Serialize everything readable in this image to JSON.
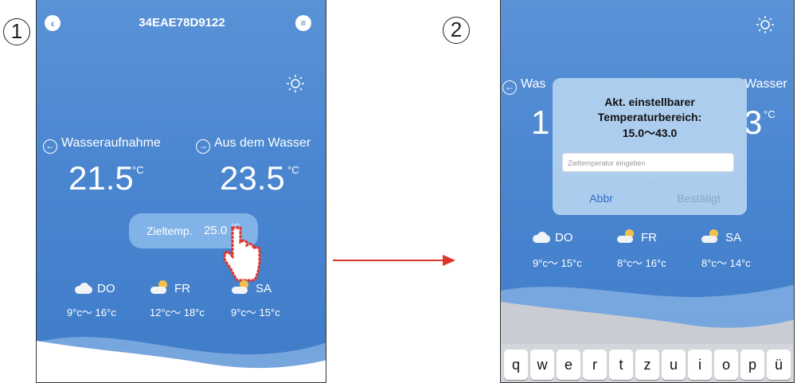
{
  "steps": {
    "one": "1",
    "two": "2"
  },
  "phone1": {
    "title": "34EAE78D9122",
    "back_icon": "chevron-left-icon",
    "menu_icon": "menu-icon",
    "sun_icon": "sun-icon",
    "inlet": {
      "label": "Wasseraufnahme",
      "value": "21.5",
      "unit": "°C"
    },
    "outlet": {
      "label": "Aus dem Wasser",
      "value": "23.5",
      "unit": "°C"
    },
    "target": {
      "label": "Zieltemp.",
      "value": "25.0",
      "unit": "°C"
    },
    "forecast": [
      {
        "day": "DO",
        "range": "9°c～ 16°c",
        "icon": "cloud-icon"
      },
      {
        "day": "FR",
        "range": "12°c～ 18°c",
        "icon": "sun-cloud-icon"
      },
      {
        "day": "SA",
        "range": "9°c～ 15°c",
        "icon": "sun-cloud-icon"
      }
    ]
  },
  "phone2": {
    "bg_left_label": "Was",
    "bg_right_label": "Wasser",
    "bg_left_value": "1",
    "bg_right_value": "3",
    "bg_unit": "°C",
    "dialog": {
      "line1": "Akt. einstellbarer",
      "line2": "Temperaturbereich:",
      "line3": "15.0～43.0",
      "placeholder": "Zieltemperatur eingeben",
      "cancel": "Abbr",
      "confirm": "Bestätigt"
    },
    "forecast": [
      {
        "day": "DO",
        "range": "9°c～ 15°c",
        "icon": "cloud-icon"
      },
      {
        "day": "FR",
        "range": "8°c～ 16°c",
        "icon": "sun-cloud-icon"
      },
      {
        "day": "SA",
        "range": "8°c～ 14°c",
        "icon": "sun-cloud-icon"
      }
    ],
    "keys": [
      "q",
      "w",
      "e",
      "r",
      "t",
      "z",
      "u",
      "i",
      "o",
      "p",
      "ü"
    ]
  },
  "colors": {
    "accent": "#4a86d0",
    "arrow": "#e0332c",
    "hand": "#e0332c"
  }
}
